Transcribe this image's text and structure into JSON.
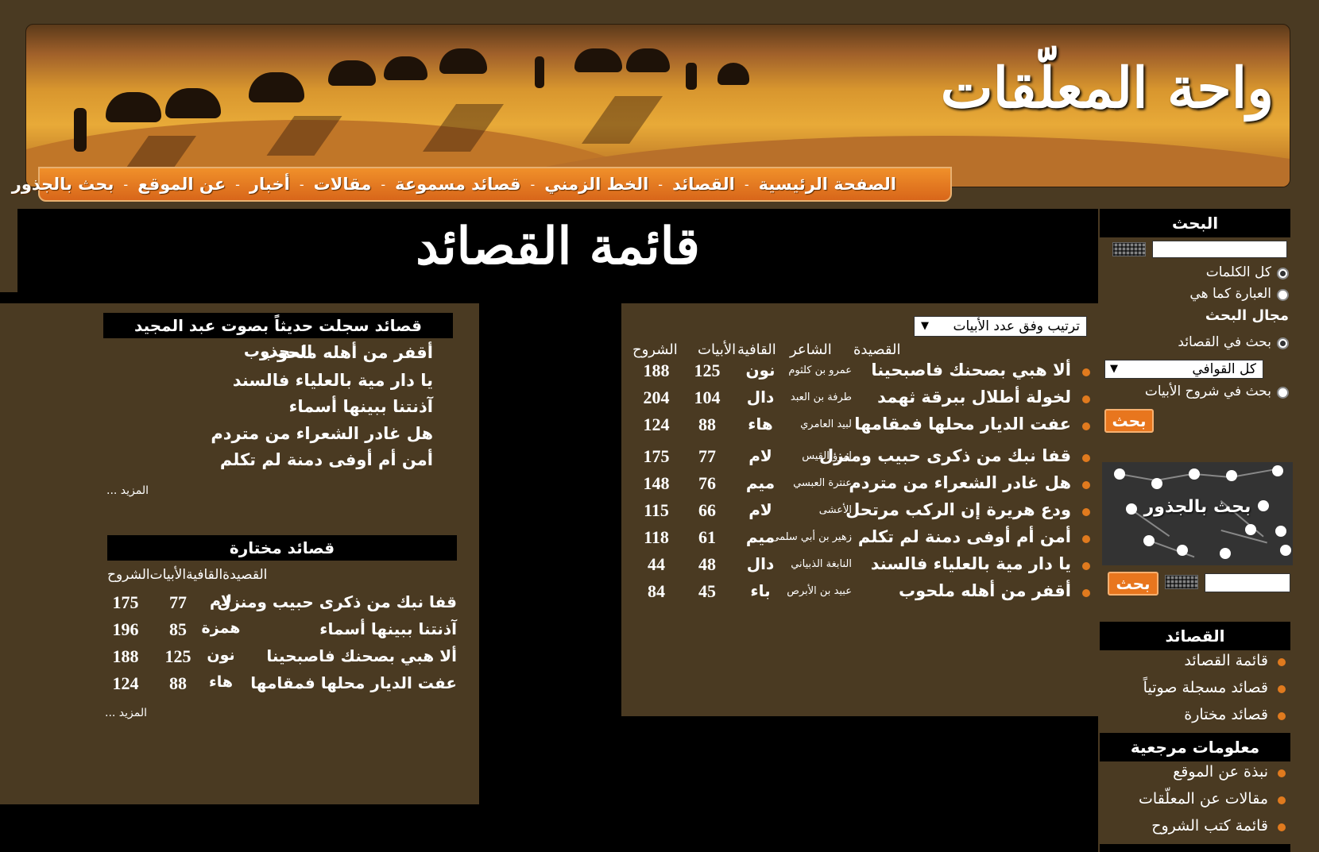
{
  "header": {
    "logo_text": "واحة المعلّقات",
    "nav": [
      "الصفحة الرئيسية",
      "القصائد",
      "الخط الزمني",
      "قصائد مسموعة",
      "مقالات",
      "أخبار",
      "عن الموقع",
      "بحث بالجذور"
    ],
    "nav_separator": "-"
  },
  "page_title": "قائمة القصائد",
  "main": {
    "sort_select": "ترتيب وفق عدد الأبيات",
    "columns": [
      "القصيدة",
      "الشاعر",
      "القافية",
      "الأبيات",
      "الشروح"
    ],
    "rows": [
      {
        "poem": "ألا هبي بصحنك فاصبحينا",
        "poet": "عمرو بن كلثوم",
        "rhyme": "نون",
        "verses": "125",
        "commentaries": "188"
      },
      {
        "poem": "لخولة أطلال ببرقة ثهمد",
        "poet": "طرفة بن العبد",
        "rhyme": "دال",
        "verses": "104",
        "commentaries": "204"
      },
      {
        "poem": "عفت الديار محلها فمقامها",
        "poet": "لبيد العامري",
        "rhyme": "هاء",
        "verses": "88",
        "commentaries": "124"
      },
      {
        "poem": "قفا نبك من ذكرى حبيب ومنزل",
        "poet": "امرؤ القيس",
        "rhyme": "لام",
        "verses": "77",
        "commentaries": "175"
      },
      {
        "poem": "هل غادر الشعراء من متردم",
        "poet": "عنترة العبسي",
        "rhyme": "ميم",
        "verses": "76",
        "commentaries": "148"
      },
      {
        "poem": "ودع هريرة إن الركب مرتحل",
        "poet": "الأعشى",
        "rhyme": "لام",
        "verses": "66",
        "commentaries": "115"
      },
      {
        "poem": "أمن أم أوفى دمنة لم تكلم",
        "poet": "زهير بن أبي سلمى",
        "rhyme": "ميم",
        "verses": "61",
        "commentaries": "118"
      },
      {
        "poem": "يا دار مية بالعلياء فالسند",
        "poet": "النابغة الذبياني",
        "rhyme": "دال",
        "verses": "48",
        "commentaries": "44"
      },
      {
        "poem": "أقفر من أهله ملحوب",
        "poet": "عبيد بن الأبرص",
        "rhyme": "باء",
        "verses": "45",
        "commentaries": "84"
      }
    ]
  },
  "recorded": {
    "title": "قصائد سجلت حديثاً بصوت عبد المجيد المجذوب",
    "items": [
      "أقفر من أهله ملحوب",
      "يا دار مية بالعلياء فالسند",
      "آذنتنا ببينها أسماء",
      "هل غادر الشعراء من متردم",
      "أمن أم أوفى دمنة لم تكلم"
    ],
    "more": "المزيد ..."
  },
  "featured": {
    "title": "قصائد مختارة",
    "columns": [
      "القصيدة",
      "القافية",
      "الأبيات",
      "الشروح"
    ],
    "rows": [
      {
        "poem": "قفا نبك من ذكرى حبيب ومنزل",
        "rhyme": "لام",
        "verses": "77",
        "commentaries": "175"
      },
      {
        "poem": "آذنتنا ببينها أسماء",
        "rhyme": "همزة",
        "verses": "85",
        "commentaries": "196"
      },
      {
        "poem": "ألا هبي بصحنك فاصبحينا",
        "rhyme": "نون",
        "verses": "125",
        "commentaries": "188"
      },
      {
        "poem": "عفت الديار محلها فمقامها",
        "rhyme": "هاء",
        "verses": "88",
        "commentaries": "124"
      }
    ],
    "more": "المزيد ..."
  },
  "sidebar": {
    "search_title": "البحث",
    "option_all_words": "كل الكلمات",
    "option_exact": "العبارة كما هي",
    "scope_title": "مجال البحث",
    "scope_poems": "بحث في القصائد",
    "rhyme_select": "كل القوافي",
    "scope_commentaries": "بحث في شروح الأبيات",
    "search_button": "بحث",
    "roots_label": "بحث بالجذور",
    "roots_button": "بحث",
    "poems_title": "القصائد",
    "poems_links": [
      "قائمة القصائد",
      "قصائد مسجلة صوتياً",
      "قصائد مختارة"
    ],
    "ref_title": "معلومات مرجعية",
    "ref_links": [
      "نبذة عن الموقع",
      "مقالات عن المعلّقات",
      "قائمة كتب الشروح"
    ]
  }
}
